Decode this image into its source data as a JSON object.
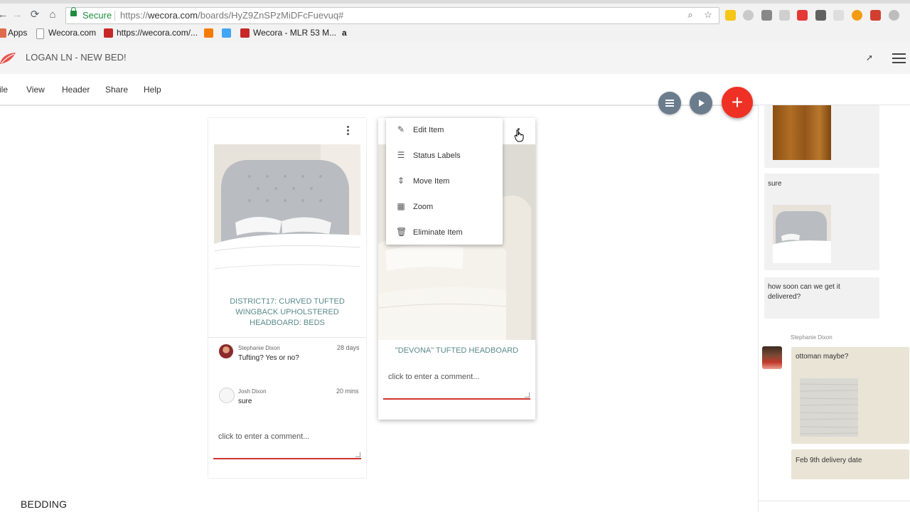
{
  "browser": {
    "secure_label": "Secure",
    "url_scheme": "https://",
    "url_host": "wecora.com",
    "url_path": "/boards/HyZ9ZnSPzMiDFcFuevuq#",
    "bookmarks": [
      {
        "label": "Apps"
      },
      {
        "label": "Wecora.com"
      },
      {
        "label": "https://wecora.com/..."
      },
      {
        "label": ""
      },
      {
        "label": ""
      },
      {
        "label": "Wecora - MLR 53 M..."
      },
      {
        "label": "a"
      }
    ]
  },
  "app": {
    "board_title": "LOGAN LN - NEW BED!",
    "share_arrow": "➚"
  },
  "menu": [
    {
      "label": "ile"
    },
    {
      "label": "View"
    },
    {
      "label": "Header"
    },
    {
      "label": "Share"
    },
    {
      "label": "Help"
    }
  ],
  "fabs": {
    "add_label": "+"
  },
  "cards": [
    {
      "title": "DISTRICT17: CURVED TUFTED WINGBACK UPHOLSTERED HEADBOARD: BEDS",
      "comments": [
        {
          "author": "Stephanie Dixon",
          "time": "28 days",
          "text": "Tufting? Yes or no?"
        },
        {
          "author": "Josh Dixon",
          "time": "20 mins",
          "text": "sure"
        }
      ],
      "comment_placeholder": "click to enter a comment..."
    },
    {
      "title": "\"DEVONA\" TUFTED HEADBOARD",
      "comment_placeholder": "click to enter a comment..."
    }
  ],
  "context_menu": [
    {
      "label": "Edit Item",
      "icon": "pencil-icon",
      "glyph": "✎"
    },
    {
      "label": "Status Labels",
      "icon": "status-labels-icon",
      "glyph": "☰"
    },
    {
      "label": "Move Item",
      "icon": "move-icon",
      "glyph": "⇕"
    },
    {
      "label": "Zoom",
      "icon": "zoom-icon",
      "glyph": "▦"
    },
    {
      "label": "Eliminate Item",
      "icon": "trash-icon",
      "glyph": "🗑"
    }
  ],
  "sidebar": {
    "msg_sure": "sure",
    "msg_delivery": "how soon can we get it delivered?",
    "author": "Stephanie Dixon",
    "msg_ottoman": "ottoman maybe?",
    "msg_feb": "Feb 9th delivery date"
  },
  "section": {
    "label": "BEDDING"
  },
  "colors": {
    "accent_red": "#ee3124",
    "fab_grey": "#6b7c8d",
    "secure_green": "#1e8e3e",
    "title_teal": "#5b8a8a"
  }
}
